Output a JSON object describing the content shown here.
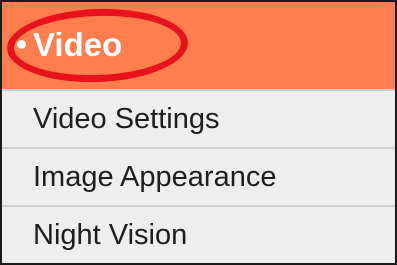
{
  "menu": {
    "header": {
      "label": "Video",
      "bullet": "•",
      "highlighted": true,
      "color": "#ff7e4f",
      "highlight_color": "#e8121d"
    },
    "items": [
      {
        "label": "Video Settings"
      },
      {
        "label": "Image Appearance"
      },
      {
        "label": "Night Vision"
      }
    ]
  }
}
